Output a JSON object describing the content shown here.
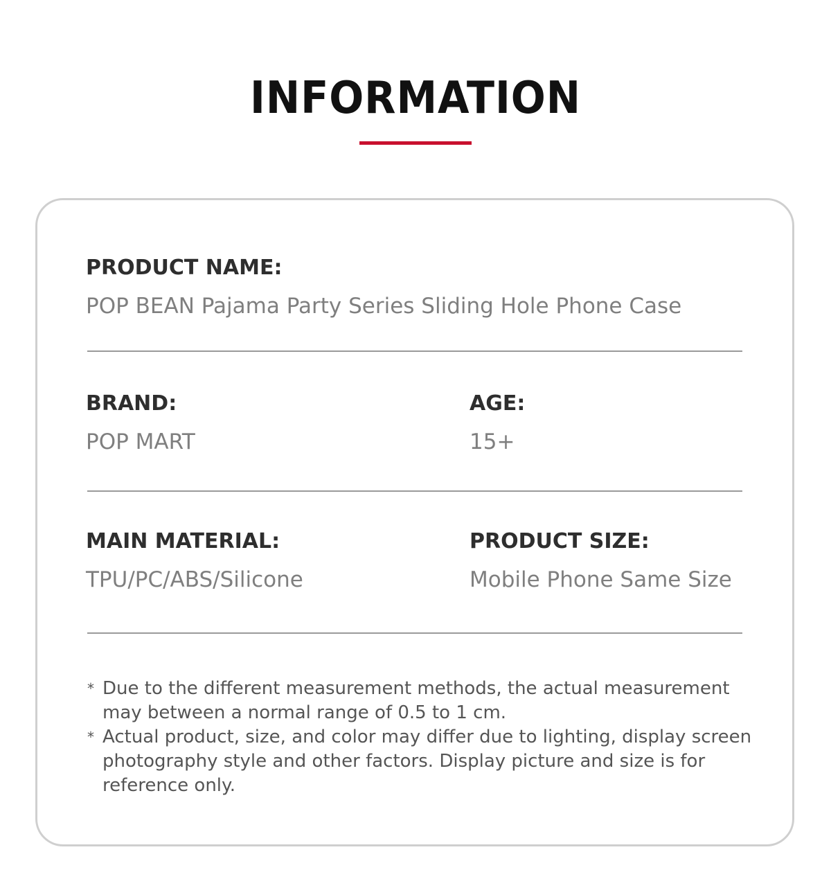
{
  "header": {
    "title": "INFORMATION",
    "accent_color": "#c8102e"
  },
  "info": {
    "product_name": {
      "label": "PRODUCT NAME:",
      "value": "POP BEAN Pajama Party Series Sliding Hole Phone Case"
    },
    "brand": {
      "label": "BRAND:",
      "value": "POP MART"
    },
    "age": {
      "label": "AGE:",
      "value": "15+"
    },
    "main_material": {
      "label": "MAIN MATERIAL:",
      "value": "TPU/PC/ABS/Silicone"
    },
    "product_size": {
      "label": "PRODUCT SIZE:",
      "value": "Mobile Phone Same Size"
    }
  },
  "notes": {
    "marker": "*",
    "items": [
      "Due to the different measurement methods, the actual measurement may between a normal range of 0.5 to 1 cm.",
      "Actual product, size, and color may differ due to lighting, display screen photography style and other factors. Display picture and size is for reference only."
    ]
  }
}
